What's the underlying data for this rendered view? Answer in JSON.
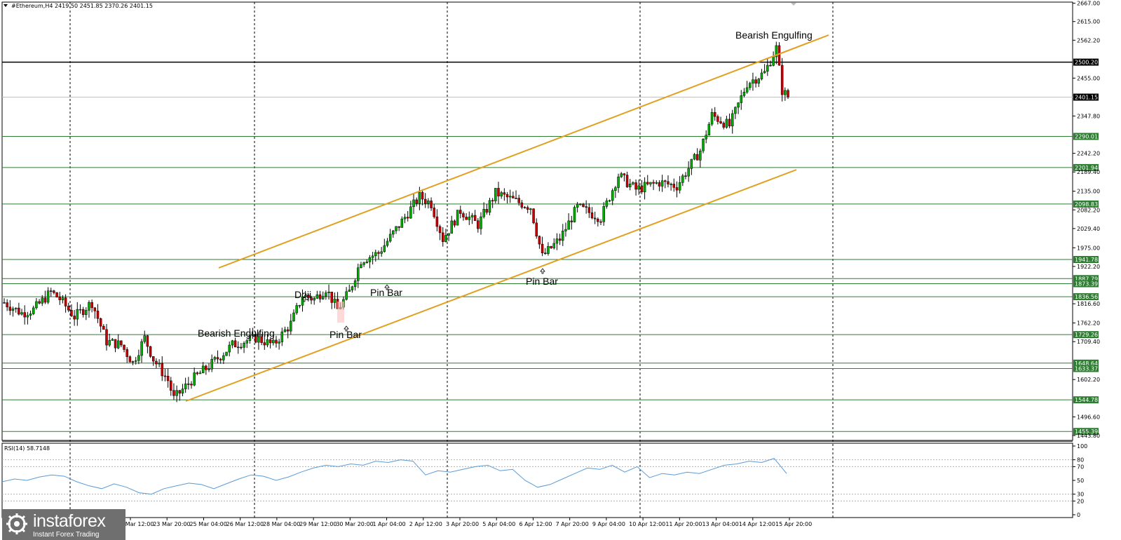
{
  "header": {
    "symbol": "#Ethereum,H4",
    "ohlc": "2419.50 2451.85 2370.26 2401.15"
  },
  "rsi_header": "RSI(14) 58.7148",
  "logo": {
    "brand": "instaforex",
    "tagline": "Instant Forex Trading"
  },
  "colors": {
    "bull": "#00b000",
    "bear": "#cc0000",
    "channel": "#e0a020",
    "level": "#2e7d32",
    "grid": "#000000",
    "rsi": "#5a9bd5"
  },
  "chart_data": [
    {
      "type": "candlestick",
      "symbol": "#Ethereum",
      "timeframe": "H4",
      "ylim": [
        1430,
        2670
      ],
      "y_ticks": [
        2667.0,
        2615.0,
        2562.2,
        2455.0,
        2347.8,
        2242.2,
        2189.4,
        2135.0,
        2082.2,
        2029.4,
        1975.0,
        1922.2,
        1816.6,
        1762.2,
        1709.4,
        1602.2,
        1496.6,
        1443.8
      ],
      "x_ticks": [
        "22 Mar 12:00",
        "23 Mar 20:00",
        "25 Mar 04:00",
        "26 Mar 12:00",
        "28 Mar 04:00",
        "29 Mar 12:00",
        "30 Mar 20:00",
        "1 Apr 04:00",
        "2 Apr 12:00",
        "3 Apr 20:00",
        "5 Apr 04:00",
        "6 Apr 12:00",
        "7 Apr 20:00",
        "9 Apr 04:00",
        "10 Apr 12:00",
        "11 Apr 20:00",
        "13 Apr 04:00",
        "14 Apr 12:00",
        "15 Apr 20:00"
      ],
      "horizontal_levels": [
        2500.2,
        2290.01,
        2201.94,
        2098.83,
        1941.78,
        1887.79,
        1873.39,
        1836.56,
        1729.26,
        1648.64,
        1633.37,
        1544.78,
        1455.39
      ],
      "current_price": 2401.15,
      "resistance_line": 2500.2,
      "annotations": [
        "Bearish Engulfing",
        "Doji",
        "Pin Bar",
        "Pin Bar",
        "Bearish Engulfing",
        "Pin Bar"
      ],
      "close_path": [
        [
          0,
          1820
        ],
        [
          6,
          1790
        ],
        [
          10,
          1800
        ],
        [
          16,
          1850
        ],
        [
          19,
          1830
        ],
        [
          24,
          1780
        ],
        [
          30,
          1820
        ],
        [
          35,
          1710
        ],
        [
          40,
          1700
        ],
        [
          44,
          1650
        ],
        [
          48,
          1720
        ],
        [
          51,
          1660
        ],
        [
          56,
          1600
        ],
        [
          58,
          1548
        ],
        [
          64,
          1600
        ],
        [
          70,
          1640
        ],
        [
          78,
          1700
        ],
        [
          86,
          1720
        ],
        [
          92,
          1700
        ],
        [
          98,
          1760
        ],
        [
          102,
          1840
        ],
        [
          106,
          1830
        ],
        [
          110,
          1860
        ],
        [
          114,
          1800
        ],
        [
          118,
          1850
        ],
        [
          122,
          1940
        ],
        [
          128,
          1960
        ],
        [
          136,
          2050
        ],
        [
          142,
          2120
        ],
        [
          146,
          2100
        ],
        [
          150,
          2000
        ],
        [
          156,
          2080
        ],
        [
          162,
          2040
        ],
        [
          168,
          2130
        ],
        [
          174,
          2110
        ],
        [
          180,
          2090
        ],
        [
          184,
          1950
        ],
        [
          190,
          2000
        ],
        [
          196,
          2090
        ],
        [
          204,
          2060
        ],
        [
          210,
          2180
        ],
        [
          216,
          2140
        ],
        [
          224,
          2160
        ],
        [
          230,
          2150
        ],
        [
          234,
          2200
        ],
        [
          238,
          2250
        ],
        [
          242,
          2350
        ],
        [
          248,
          2320
        ],
        [
          254,
          2440
        ],
        [
          260,
          2470
        ],
        [
          264,
          2540
        ],
        [
          266,
          2420
        ],
        [
          268,
          2401
        ]
      ]
    },
    {
      "type": "line",
      "name": "RSI(14)",
      "value": 58.7148,
      "ylim": [
        0,
        100
      ],
      "y_ticks": [
        100,
        80,
        70,
        50,
        30,
        20,
        0
      ],
      "values": [
        48,
        52,
        50,
        55,
        58,
        56,
        48,
        42,
        38,
        45,
        40,
        32,
        30,
        38,
        42,
        46,
        44,
        38,
        45,
        52,
        58,
        56,
        50,
        55,
        62,
        68,
        72,
        70,
        74,
        72,
        78,
        76,
        80,
        78,
        58,
        64,
        62,
        66,
        70,
        72,
        64,
        66,
        50,
        40,
        44,
        52,
        60,
        68,
        66,
        72,
        62,
        70,
        54,
        60,
        58,
        62,
        60,
        66,
        72,
        74,
        78,
        76,
        82,
        60
      ]
    }
  ]
}
